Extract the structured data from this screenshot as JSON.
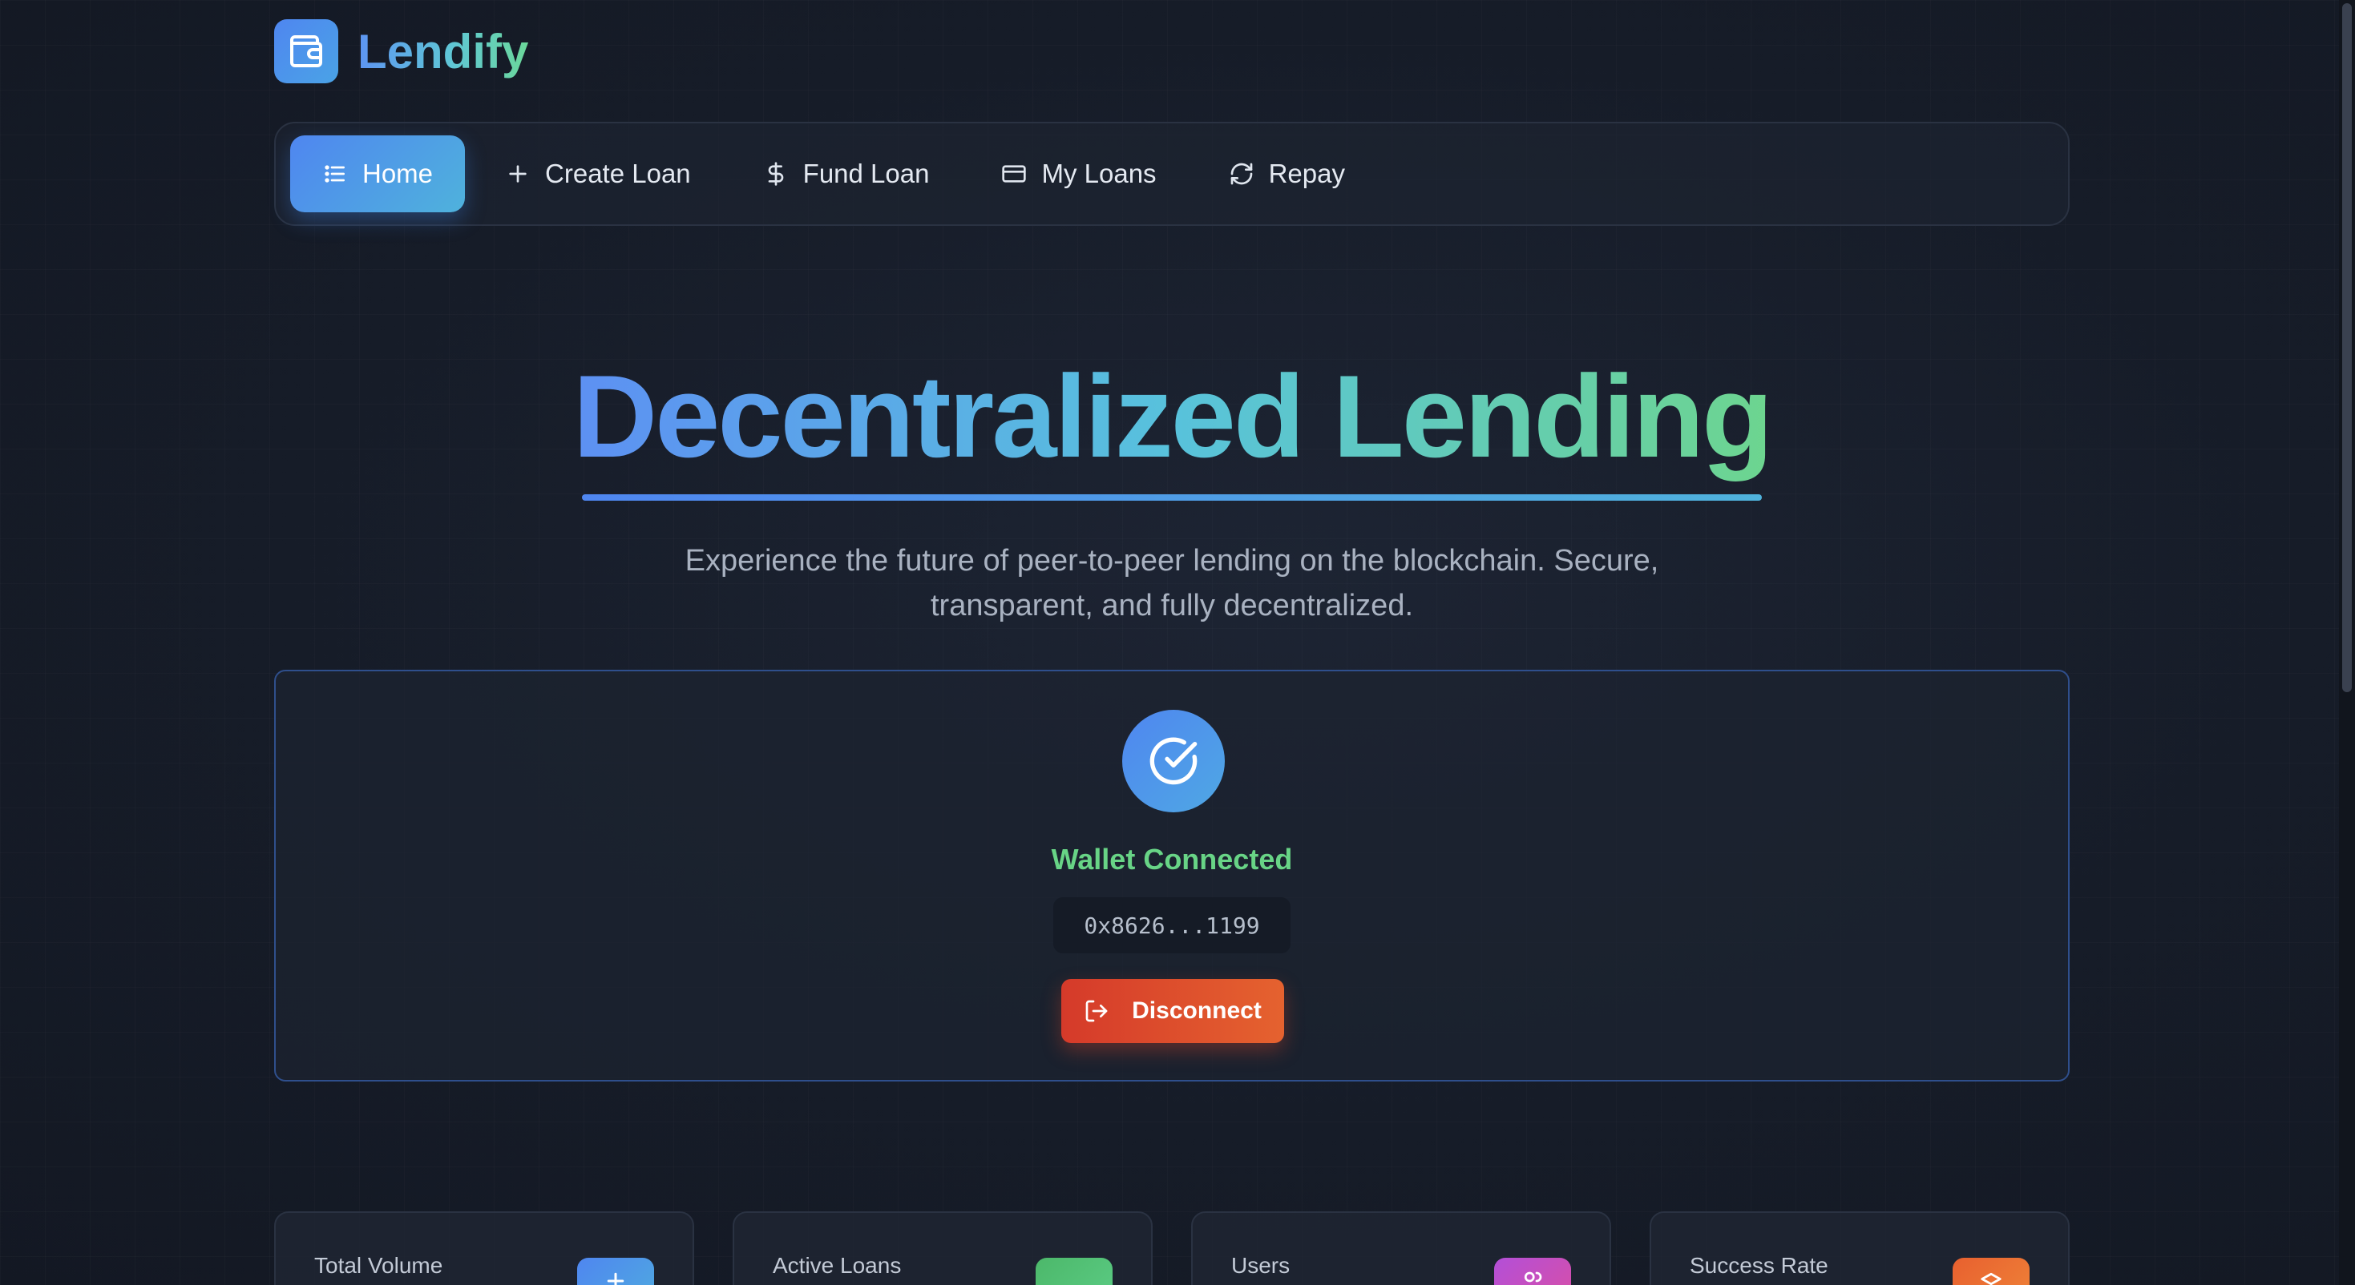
{
  "brand": {
    "name": "Lendify",
    "logo_icon": "wallet-icon"
  },
  "nav": {
    "items": [
      {
        "label": "Home",
        "icon": "list-icon",
        "active": true
      },
      {
        "label": "Create Loan",
        "icon": "plus-icon",
        "active": false
      },
      {
        "label": "Fund Loan",
        "icon": "dollar-icon",
        "active": false
      },
      {
        "label": "My Loans",
        "icon": "credit-card-icon",
        "active": false
      },
      {
        "label": "Repay",
        "icon": "refresh-icon",
        "active": false
      }
    ]
  },
  "hero": {
    "title": "Decentralized Lending",
    "subtitle": "Experience the future of peer-to-peer lending on the blockchain. Secure, transparent, and fully decentralized."
  },
  "wallet": {
    "status": "Wallet Connected",
    "address": "0x8626...1199",
    "disconnect_label": "Disconnect",
    "status_icon": "check-circle-icon"
  },
  "stats": [
    {
      "label": "Total Volume",
      "icon": "stat-icon",
      "color": "#4f86f0"
    },
    {
      "label": "Active Loans",
      "icon": "stat-icon",
      "color": "#4cb86a"
    },
    {
      "label": "Users",
      "icon": "users-icon",
      "color": "#b34fd8"
    },
    {
      "label": "Success Rate",
      "icon": "stat-icon",
      "color": "#e8602f"
    }
  ],
  "colors": {
    "accent_blue": "#4f86f0",
    "accent_green": "#68d486",
    "danger": "#d53a2a",
    "background": "#161c28"
  }
}
